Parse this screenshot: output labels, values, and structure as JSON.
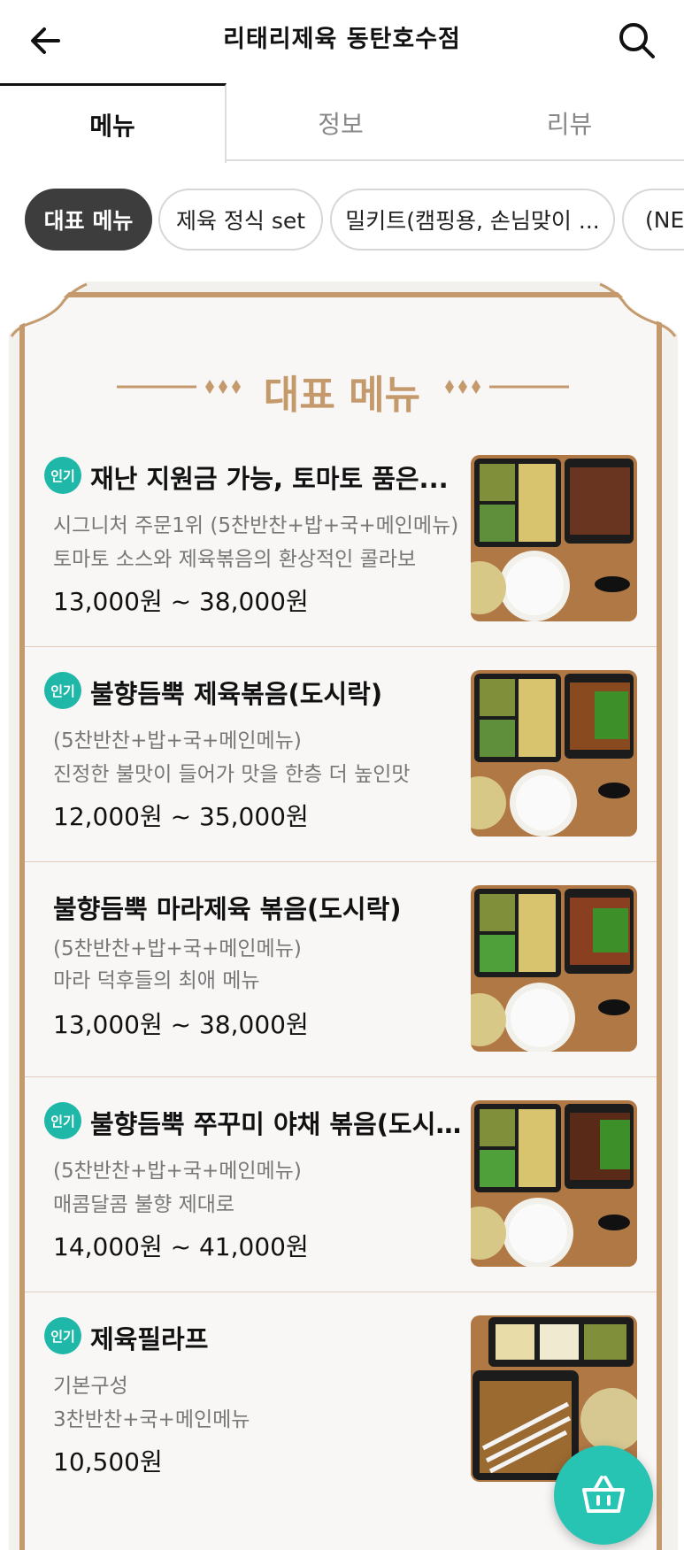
{
  "header": {
    "title": "리태리제육 동탄호수점",
    "back_icon": "arrow-left-icon",
    "search_icon": "search-icon"
  },
  "tabs": [
    {
      "label": "메뉴",
      "active": true
    },
    {
      "label": "정보",
      "active": false
    },
    {
      "label": "리뷰",
      "active": false
    }
  ],
  "categories": [
    {
      "label": "대표 메뉴",
      "active": true
    },
    {
      "label": "제육 정식 set",
      "active": false
    },
    {
      "label": "밀키트(캠핑용, 손님맞이 ...",
      "active": false
    },
    {
      "label": "(NEW",
      "active": false
    }
  ],
  "section": {
    "title": "대표 메뉴",
    "accent_color": "#c49a6c"
  },
  "menu_items": [
    {
      "badge": "인기",
      "name": "재난 지원금 가능, 토마토 품은...",
      "desc_lines": [
        "시그니처 주문1위 (5찬반찬+밥+국+메인메뉴)",
        "토마토 소스와 제육볶음의 환상적인  콜라보"
      ],
      "price": "13,000원 ~ 38,000원"
    },
    {
      "badge": "인기",
      "name": "불향듬뿍 제육볶음(도시락)",
      "desc_lines": [
        "(5찬반찬+밥+국+메인메뉴)",
        "진정한 불맛이 들어가 맛을 한층 더 높인맛"
      ],
      "price": "12,000원 ~ 35,000원"
    },
    {
      "badge": "",
      "name": "불향듬뿍 마라제육 볶음(도시락)",
      "desc_lines": [
        "(5찬반찬+밥+국+메인메뉴)",
        "마라 덕후들의  최애 메뉴"
      ],
      "price": "13,000원 ~ 38,000원"
    },
    {
      "badge": "인기",
      "name": "불향듬뿍 쭈꾸미 야채 볶음(도시...",
      "desc_lines": [
        "(5찬반찬+밥+국+메인메뉴)",
        "매콤달콤 불향 제대로"
      ],
      "price": "14,000원 ~ 41,000원"
    },
    {
      "badge": "인기",
      "name": "제육필라프",
      "desc_lines": [
        "기본구성",
        "3찬반찬+국+메인메뉴"
      ],
      "price": "10,500원"
    }
  ],
  "cart": {
    "icon": "shopping-basket-icon",
    "color": "#27c3b3"
  },
  "colors": {
    "badge": "#1fb8a8",
    "active_chip": "#3d3d3d",
    "board_border": "#c49a6c"
  }
}
